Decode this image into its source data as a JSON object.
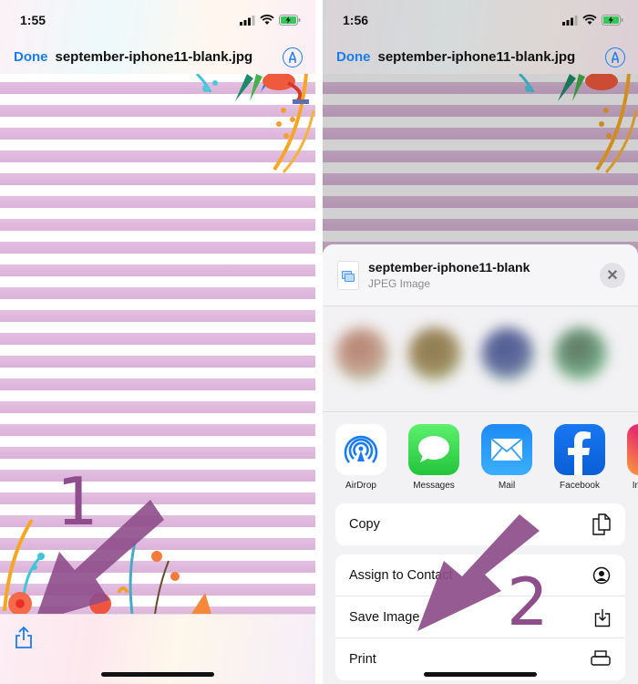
{
  "left_screen": {
    "status": {
      "time": "1:55"
    },
    "nav": {
      "done_label": "Done",
      "title": "september-iphone11-blank.jpg"
    },
    "step_number": "1"
  },
  "right_screen": {
    "status": {
      "time": "1:56"
    },
    "nav": {
      "done_label": "Done",
      "title": "september-iphone11-blank.jpg"
    },
    "share_sheet": {
      "file_name": "september-iphone11-blank",
      "file_type": "JPEG Image",
      "apps": [
        {
          "label": "AirDrop",
          "icon": "airdrop-icon"
        },
        {
          "label": "Messages",
          "icon": "messages-icon"
        },
        {
          "label": "Mail",
          "icon": "mail-icon"
        },
        {
          "label": "Facebook",
          "icon": "facebook-icon"
        },
        {
          "label": "Instagram",
          "icon": "instagram-icon"
        }
      ],
      "actions": [
        {
          "label": "Copy",
          "icon": "copy-icon"
        },
        {
          "label": "Assign to Contact",
          "icon": "contact-icon"
        },
        {
          "label": "Save Image",
          "icon": "save-image-icon"
        },
        {
          "label": "Print",
          "icon": "print-icon"
        }
      ]
    },
    "step_number": "2"
  },
  "colors": {
    "accent": "#1a7cf0",
    "annotation": "#8e4d8b",
    "stripe": "#dcb3da"
  }
}
